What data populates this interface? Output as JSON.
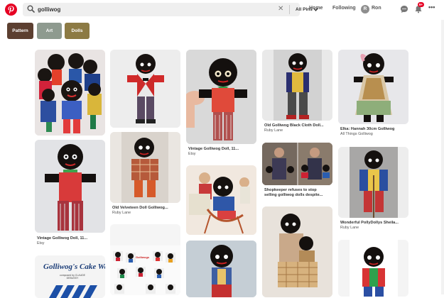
{
  "header": {
    "search_value": "golliwog",
    "search_placeholder": "Search",
    "filter_dropdown": "All Pins",
    "nav": {
      "home": "Home",
      "following": "Following",
      "avatar_initial": "R",
      "user": "Ron"
    },
    "notification_badge": "9+",
    "more_label": "•••"
  },
  "chips": [
    {
      "label": "Pattern",
      "color": "#5c3f30"
    },
    {
      "label": "Art",
      "color": "#8e9a8f"
    },
    {
      "label": "Dolls",
      "color": "#8c7a44"
    }
  ],
  "pins": [
    {
      "title": "",
      "source": ""
    },
    {
      "title": "",
      "source": ""
    },
    {
      "title": "Vintage Golliwog Doll, 11...",
      "source": "Etsy"
    },
    {
      "title": "Old Golliwog Black Cloth Doll...",
      "source": "Ruby Lane"
    },
    {
      "title": "Elka: Hannah 30cm Golliwog",
      "source": "All Things Golliwog"
    },
    {
      "title": "Vintage Golliwog Doll, 11...",
      "source": "Etsy"
    },
    {
      "title": "Old Velveteen Doll Golliwog...",
      "source": "Ruby Lane"
    },
    {
      "title": "",
      "source": ""
    },
    {
      "title": "Shopkeeper refuses to stop",
      "title2": "selling golliwog dolls despite...",
      "source": ""
    },
    {
      "title": "Wonderful PollyDollys Sheila...",
      "source": "Ruby Lane"
    },
    {
      "title": "",
      "source": "",
      "cover_title": "Golliwog's Cake Walk",
      "cover_small": "composed by CLAUDE DEBUSSY"
    },
    {
      "title": "",
      "source": "",
      "inner_label": "Golliwogs"
    },
    {
      "title": "",
      "source": ""
    },
    {
      "title": "",
      "source": ""
    },
    {
      "title": "",
      "source": ""
    }
  ],
  "colors": {
    "brand": "#e60023",
    "search_bg": "#efefef"
  }
}
